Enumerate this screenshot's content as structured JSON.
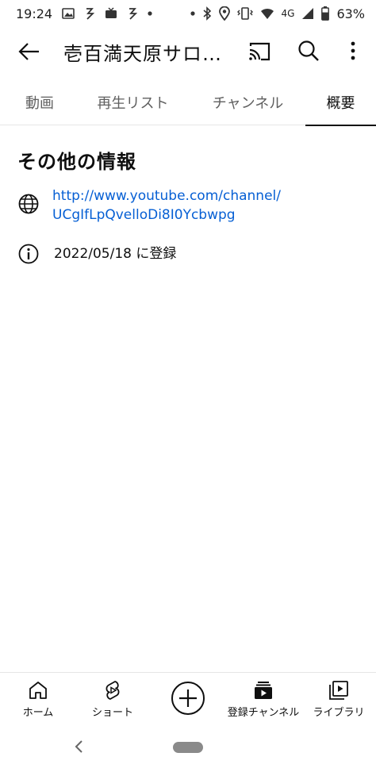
{
  "status_bar": {
    "time": "19:24",
    "network": "4G",
    "battery": "63%",
    "icons": [
      "gallery-icon",
      "notification-icon",
      "tv-icon",
      "notification-icon",
      "dot-icon",
      "dot-icon",
      "bluetooth-icon",
      "location-icon",
      "vibrate-icon",
      "wifi-icon",
      "signal-icon",
      "battery-icon"
    ]
  },
  "app_bar": {
    "title": "壱百満天原サロ…"
  },
  "tabs": [
    {
      "label": "動画",
      "active": false
    },
    {
      "label": "再生リスト",
      "active": false
    },
    {
      "label": "チャンネル",
      "active": false
    },
    {
      "label": "概要",
      "active": true
    }
  ],
  "about": {
    "section_title": "その他の情報",
    "link": "http://www.youtube.com/channel/UCgIfLpQvelloDi8I0Ycbwpg",
    "joined": "2022/05/18 に登録"
  },
  "bottom_nav": {
    "home": "ホーム",
    "shorts": "ショート",
    "subscriptions": "登録チャンネル",
    "library": "ライブラリ"
  },
  "colors": {
    "link": "#065fd4",
    "text": "#0f0f0f",
    "secondary": "#606060"
  }
}
